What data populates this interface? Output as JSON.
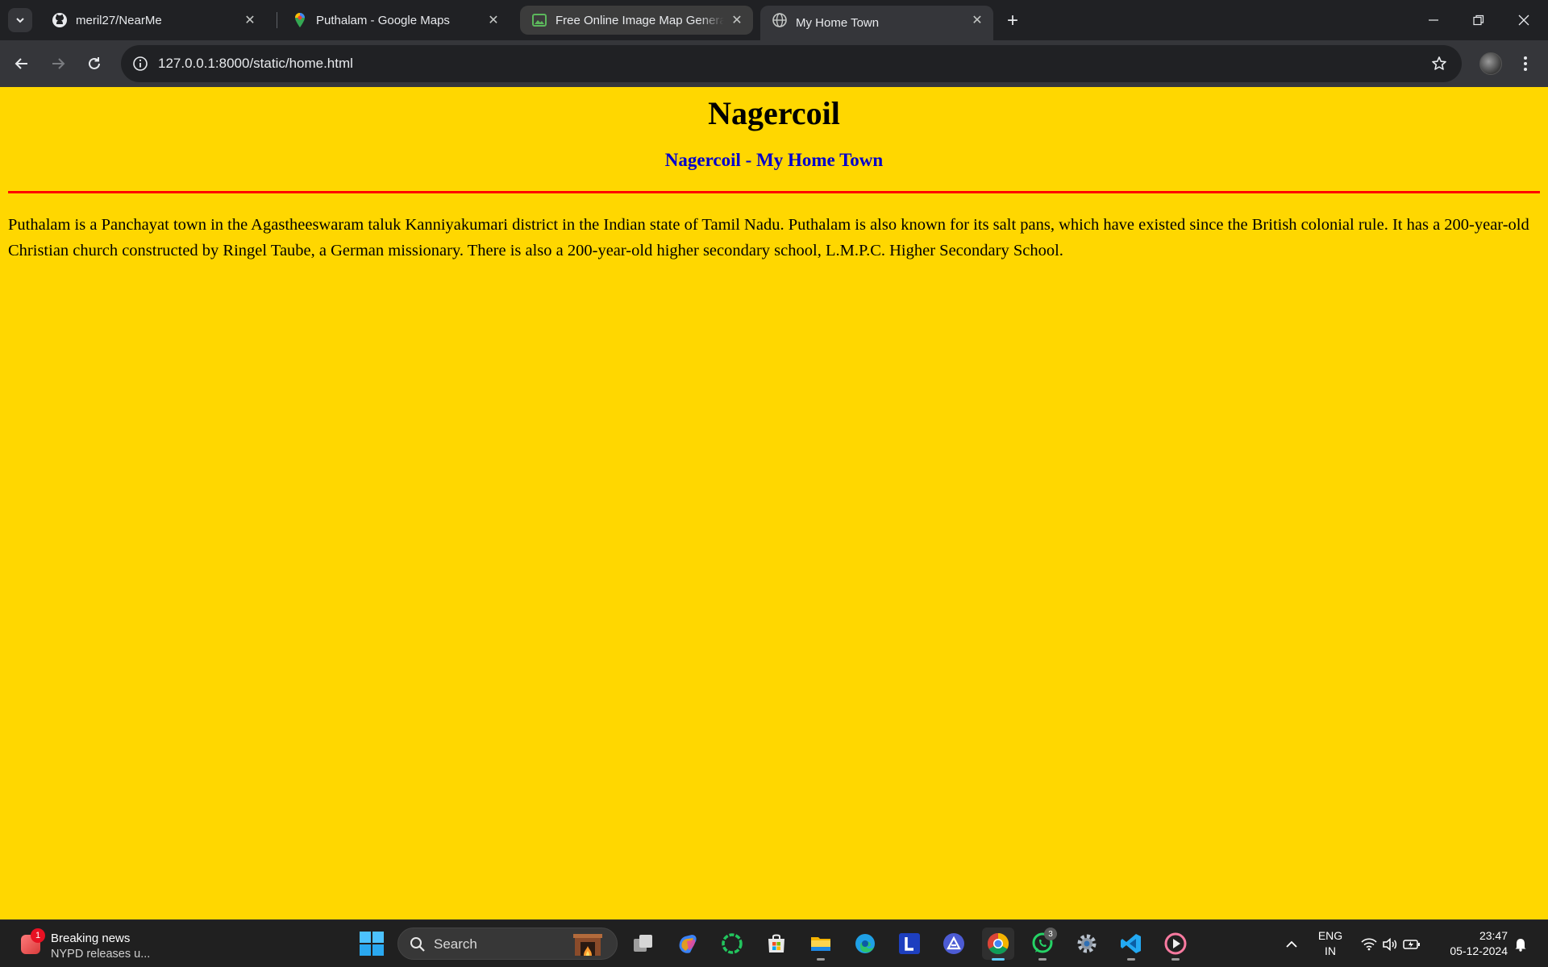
{
  "browser": {
    "tabs": [
      {
        "title": "meril27/NearMe",
        "favicon": "github-icon"
      },
      {
        "title": "Puthalam - Google Maps",
        "favicon": "google-maps-icon"
      },
      {
        "title": "Free Online Image Map Generator",
        "favicon": "image-icon"
      },
      {
        "title": "My Home Town",
        "favicon": "globe-icon"
      }
    ],
    "active_tab": 3,
    "address": "127.0.0.1:8000/static/home.html"
  },
  "page": {
    "heading": "Nagercoil",
    "subheading": "Nagercoil - My Home Town",
    "paragraph": "Puthalam is a Panchayat town in the Agastheeswaram taluk Kanniyakumari district in the Indian state of Tamil Nadu. Puthalam is also known for its salt pans, which have existed since the British colonial rule. It has a 200-year-old Christian church constructed by Ringel Taube, a German missionary. There is also a 200-year-old higher secondary school, L.M.P.C. Higher Secondary School.",
    "colors": {
      "background": "#FFD700",
      "subheading": "#0000CD",
      "rule": "#FF0000"
    }
  },
  "taskbar": {
    "news": {
      "badge": "1",
      "title": "Breaking news",
      "subtitle": "NYPD releases u..."
    },
    "search_label": "Search",
    "whatsapp_badge": "3",
    "language_line1": "ENG",
    "language_line2": "IN",
    "time": "23:47",
    "date": "05-12-2024"
  }
}
